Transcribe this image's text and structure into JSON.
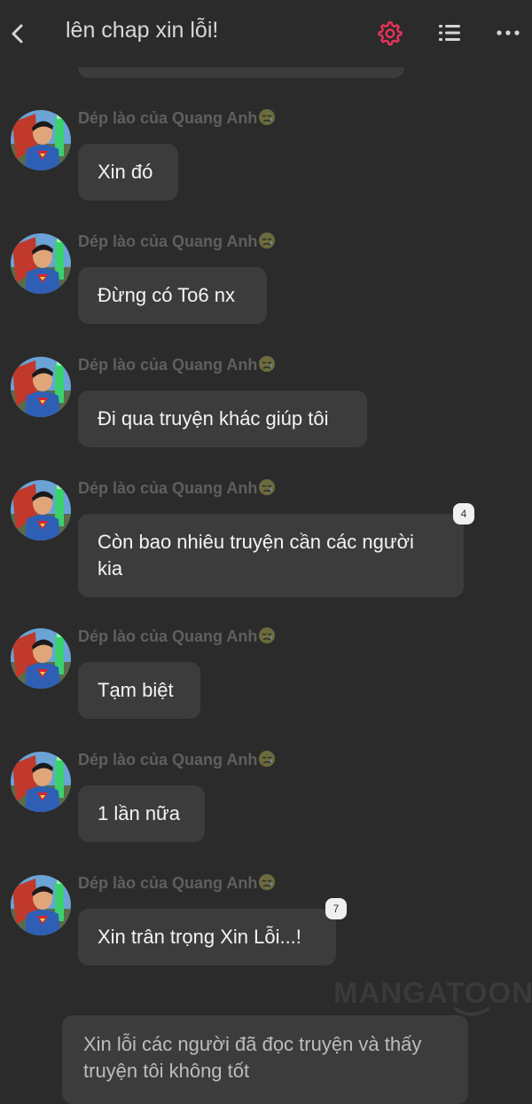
{
  "header": {
    "title": "lên chap xin lỗi!",
    "back_icon": "chevron-left-icon",
    "settings_icon": "gear-icon",
    "list_icon": "list-icon",
    "more_icon": "more-dots-icon",
    "accent_color": "#e8335a"
  },
  "messages": [
    {
      "sender": "Dép lào của Quang Anh",
      "text": "Xin đó",
      "badge": null
    },
    {
      "sender": "Dép lào của Quang Anh",
      "text": "Đừng có To6 nx",
      "badge": null
    },
    {
      "sender": "Dép lào của Quang Anh",
      "text": "Đi qua truyện khác giúp tôi",
      "badge": null
    },
    {
      "sender": "Dép lào của Quang Anh",
      "text": "Còn bao nhiêu truyện cần các người kia",
      "badge": "4"
    },
    {
      "sender": "Dép lào của Quang Anh",
      "text": "Tạm biệt",
      "badge": null
    },
    {
      "sender": "Dép lào của Quang Anh",
      "text": "1 lần nữa",
      "badge": null
    },
    {
      "sender": "Dép lào của Quang Anh",
      "text": "Xin trân trọng Xin Lỗi...!",
      "badge": "7"
    }
  ],
  "watermark": "MANGATOON",
  "footer_note": "Xin lỗi các người đã đọc truyện và thấy truyện tôi không tốt"
}
